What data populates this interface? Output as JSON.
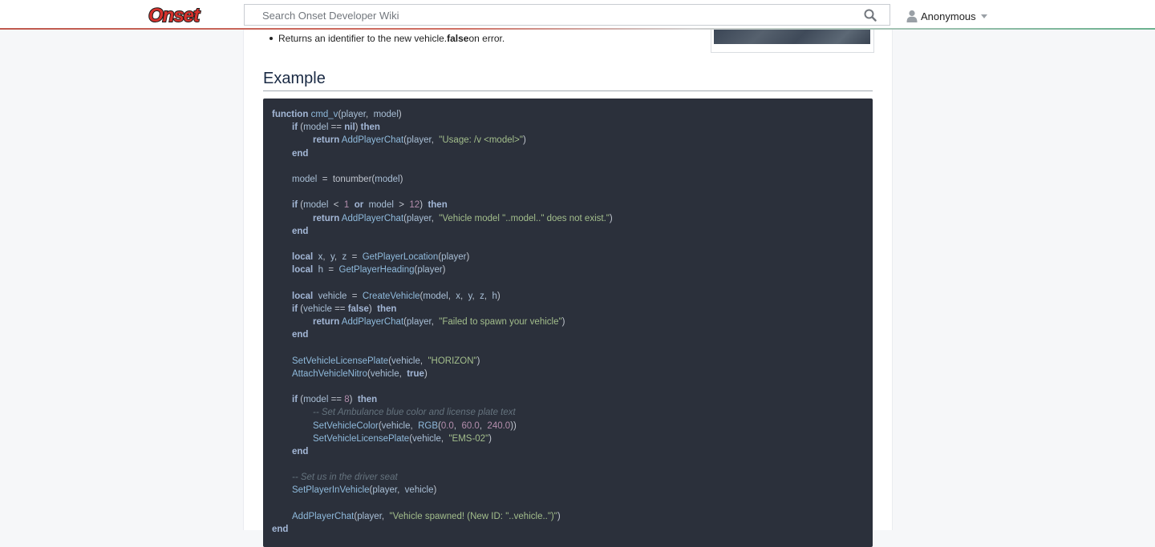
{
  "header": {
    "logo_text": "Onset",
    "search_placeholder": "Search Onset Developer Wiki",
    "user_name": "Anonymous",
    "colors": {
      "logo_red": "#d6322d",
      "accent_line": "#b43b2e"
    }
  },
  "content": {
    "return_bullet": {
      "prefix": "Returns an identifier to the new vehicle. ",
      "bold": "false",
      "suffix": " on error."
    },
    "section_title": "Example",
    "code": [
      {
        "indent": 0,
        "tokens": [
          [
            "kw",
            "function"
          ],
          [
            "plain",
            " "
          ],
          [
            "fn",
            "cmd_v"
          ],
          [
            "plain",
            "("
          ],
          [
            "id",
            "player"
          ],
          [
            "plain",
            ",  "
          ],
          [
            "id",
            "model"
          ],
          [
            "plain",
            ")"
          ]
        ]
      },
      {
        "indent": 1,
        "tokens": [
          [
            "kw",
            "if"
          ],
          [
            "plain",
            " ("
          ],
          [
            "id",
            "model"
          ],
          [
            "plain",
            " == "
          ],
          [
            "kw",
            "nil"
          ],
          [
            "plain",
            ") "
          ],
          [
            "kw",
            "then"
          ]
        ]
      },
      {
        "indent": 2,
        "tokens": [
          [
            "kw",
            "return"
          ],
          [
            "plain",
            " "
          ],
          [
            "fn",
            "AddPlayerChat"
          ],
          [
            "plain",
            "("
          ],
          [
            "id",
            "player"
          ],
          [
            "plain",
            ",  "
          ],
          [
            "str",
            "\"Usage: /v <model>\""
          ],
          [
            "plain",
            ")"
          ]
        ]
      },
      {
        "indent": 1,
        "tokens": [
          [
            "kw",
            "end"
          ]
        ]
      },
      {
        "indent": 0,
        "tokens": []
      },
      {
        "indent": 1,
        "tokens": [
          [
            "id",
            "model"
          ],
          [
            "plain",
            "  =  tonumber("
          ],
          [
            "id",
            "model"
          ],
          [
            "plain",
            ")"
          ]
        ]
      },
      {
        "indent": 0,
        "tokens": []
      },
      {
        "indent": 1,
        "tokens": [
          [
            "kw",
            "if"
          ],
          [
            "plain",
            " ("
          ],
          [
            "id",
            "model"
          ],
          [
            "plain",
            "  <  "
          ],
          [
            "num",
            "1"
          ],
          [
            "plain",
            "  "
          ],
          [
            "kw",
            "or"
          ],
          [
            "plain",
            "  "
          ],
          [
            "id",
            "model"
          ],
          [
            "plain",
            "  >  "
          ],
          [
            "num",
            "12"
          ],
          [
            "plain",
            ")  "
          ],
          [
            "kw",
            "then"
          ]
        ]
      },
      {
        "indent": 2,
        "tokens": [
          [
            "kw",
            "return"
          ],
          [
            "plain",
            " "
          ],
          [
            "fn",
            "AddPlayerChat"
          ],
          [
            "plain",
            "("
          ],
          [
            "id",
            "player"
          ],
          [
            "plain",
            ",  "
          ],
          [
            "str",
            "\"Vehicle model \"..model..\" does not exist.\""
          ],
          [
            "plain",
            ")"
          ]
        ]
      },
      {
        "indent": 1,
        "tokens": [
          [
            "kw",
            "end"
          ]
        ]
      },
      {
        "indent": 0,
        "tokens": []
      },
      {
        "indent": 1,
        "tokens": [
          [
            "kw",
            "local"
          ],
          [
            "plain",
            "  "
          ],
          [
            "id",
            "x"
          ],
          [
            "plain",
            ",  "
          ],
          [
            "id",
            "y"
          ],
          [
            "plain",
            ",  "
          ],
          [
            "id",
            "z"
          ],
          [
            "plain",
            "  =  "
          ],
          [
            "fn",
            "GetPlayerLocation"
          ],
          [
            "plain",
            "("
          ],
          [
            "id",
            "player"
          ],
          [
            "plain",
            ")"
          ]
        ]
      },
      {
        "indent": 1,
        "tokens": [
          [
            "kw",
            "local"
          ],
          [
            "plain",
            "  "
          ],
          [
            "id",
            "h"
          ],
          [
            "plain",
            "  =  "
          ],
          [
            "fn",
            "GetPlayerHeading"
          ],
          [
            "plain",
            "("
          ],
          [
            "id",
            "player"
          ],
          [
            "plain",
            ")"
          ]
        ]
      },
      {
        "indent": 0,
        "tokens": []
      },
      {
        "indent": 1,
        "tokens": [
          [
            "kw",
            "local"
          ],
          [
            "plain",
            "  "
          ],
          [
            "id",
            "vehicle"
          ],
          [
            "plain",
            "  =  "
          ],
          [
            "fn",
            "CreateVehicle"
          ],
          [
            "plain",
            "("
          ],
          [
            "id",
            "model"
          ],
          [
            "plain",
            ",  "
          ],
          [
            "id",
            "x"
          ],
          [
            "plain",
            ",  "
          ],
          [
            "id",
            "y"
          ],
          [
            "plain",
            ",  "
          ],
          [
            "id",
            "z"
          ],
          [
            "plain",
            ",  "
          ],
          [
            "id",
            "h"
          ],
          [
            "plain",
            ")"
          ]
        ]
      },
      {
        "indent": 1,
        "tokens": [
          [
            "kw",
            "if"
          ],
          [
            "plain",
            " ("
          ],
          [
            "id",
            "vehicle"
          ],
          [
            "plain",
            " == "
          ],
          [
            "kw",
            "false"
          ],
          [
            "plain",
            ")  "
          ],
          [
            "kw",
            "then"
          ]
        ]
      },
      {
        "indent": 2,
        "tokens": [
          [
            "kw",
            "return"
          ],
          [
            "plain",
            " "
          ],
          [
            "fn",
            "AddPlayerChat"
          ],
          [
            "plain",
            "("
          ],
          [
            "id",
            "player"
          ],
          [
            "plain",
            ",  "
          ],
          [
            "str",
            "\"Failed to spawn your vehicle\""
          ],
          [
            "plain",
            ")"
          ]
        ]
      },
      {
        "indent": 1,
        "tokens": [
          [
            "kw",
            "end"
          ]
        ]
      },
      {
        "indent": 0,
        "tokens": []
      },
      {
        "indent": 1,
        "tokens": [
          [
            "fn",
            "SetVehicleLicensePlate"
          ],
          [
            "plain",
            "("
          ],
          [
            "id",
            "vehicle"
          ],
          [
            "plain",
            ",  "
          ],
          [
            "str",
            "\"HORIZON\""
          ],
          [
            "plain",
            ")"
          ]
        ]
      },
      {
        "indent": 1,
        "tokens": [
          [
            "fn",
            "AttachVehicleNitro"
          ],
          [
            "plain",
            "("
          ],
          [
            "id",
            "vehicle"
          ],
          [
            "plain",
            ",  "
          ],
          [
            "kw",
            "true"
          ],
          [
            "plain",
            ")"
          ]
        ]
      },
      {
        "indent": 0,
        "tokens": []
      },
      {
        "indent": 1,
        "tokens": [
          [
            "kw",
            "if"
          ],
          [
            "plain",
            " ("
          ],
          [
            "id",
            "model"
          ],
          [
            "plain",
            " == "
          ],
          [
            "num",
            "8"
          ],
          [
            "plain",
            ")  "
          ],
          [
            "kw",
            "then"
          ]
        ]
      },
      {
        "indent": 2,
        "tokens": [
          [
            "cmt",
            "-- Set Ambulance blue color and license plate text"
          ]
        ]
      },
      {
        "indent": 2,
        "tokens": [
          [
            "fn",
            "SetVehicleColor"
          ],
          [
            "plain",
            "("
          ],
          [
            "id",
            "vehicle"
          ],
          [
            "plain",
            ",  "
          ],
          [
            "fn",
            "RGB"
          ],
          [
            "plain",
            "("
          ],
          [
            "num",
            "0.0"
          ],
          [
            "plain",
            ",  "
          ],
          [
            "num",
            "60.0"
          ],
          [
            "plain",
            ",  "
          ],
          [
            "num",
            "240.0"
          ],
          [
            "plain",
            "))"
          ]
        ]
      },
      {
        "indent": 2,
        "tokens": [
          [
            "fn",
            "SetVehicleLicensePlate"
          ],
          [
            "plain",
            "("
          ],
          [
            "id",
            "vehicle"
          ],
          [
            "plain",
            ",  "
          ],
          [
            "str",
            "\"EMS-02\""
          ],
          [
            "plain",
            ")"
          ]
        ]
      },
      {
        "indent": 1,
        "tokens": [
          [
            "kw",
            "end"
          ]
        ]
      },
      {
        "indent": 0,
        "tokens": []
      },
      {
        "indent": 1,
        "tokens": [
          [
            "cmt",
            "-- Set us in the driver seat"
          ]
        ]
      },
      {
        "indent": 1,
        "tokens": [
          [
            "fn",
            "SetPlayerInVehicle"
          ],
          [
            "plain",
            "("
          ],
          [
            "id",
            "player"
          ],
          [
            "plain",
            ",  "
          ],
          [
            "id",
            "vehicle"
          ],
          [
            "plain",
            ")"
          ]
        ]
      },
      {
        "indent": 0,
        "tokens": []
      },
      {
        "indent": 1,
        "tokens": [
          [
            "fn",
            "AddPlayerChat"
          ],
          [
            "plain",
            "("
          ],
          [
            "id",
            "player"
          ],
          [
            "plain",
            ",  "
          ],
          [
            "str",
            "\"Vehicle spawned! (New ID: \"..vehicle..\")\""
          ],
          [
            "plain",
            ")"
          ]
        ]
      },
      {
        "indent": 0,
        "tokens": [
          [
            "kw",
            "end"
          ]
        ]
      }
    ]
  }
}
